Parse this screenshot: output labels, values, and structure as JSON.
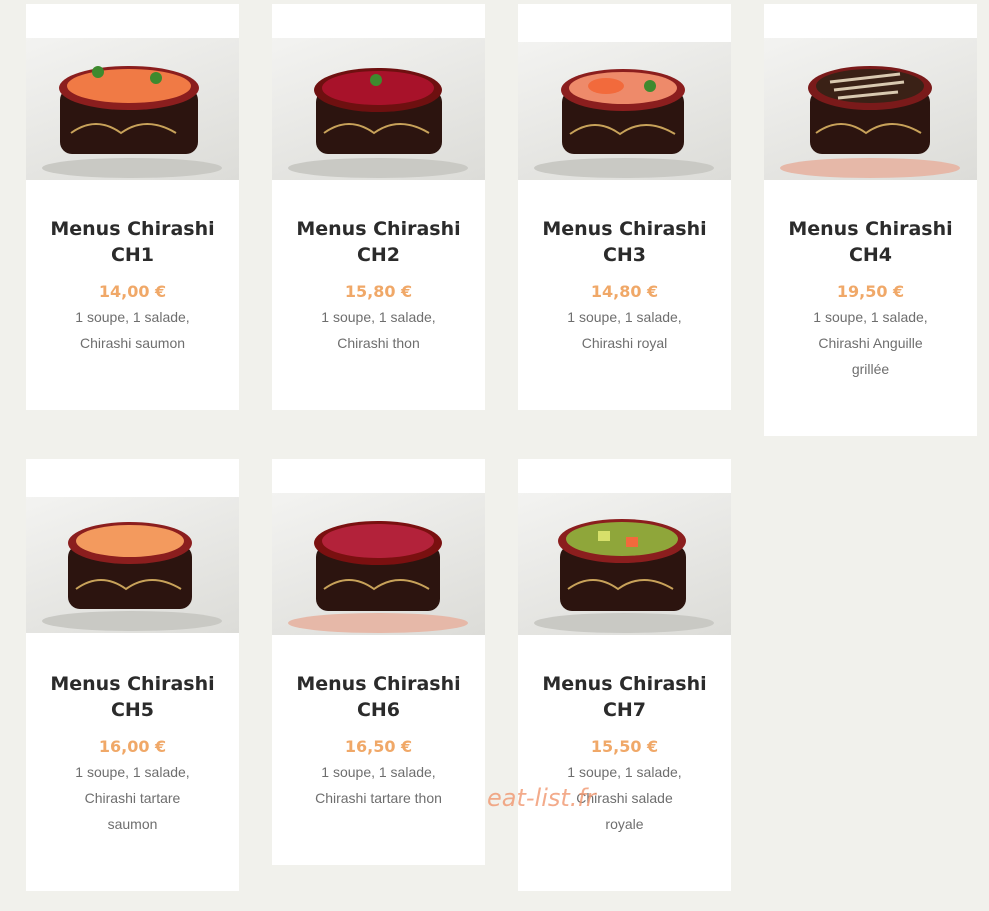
{
  "menu": {
    "items": [
      {
        "title": "Menus Chirashi\nCH1",
        "price": "14,00 €",
        "desc_line1": "1 soupe, 1 salade,",
        "desc_line2": "Chirashi saumon",
        "desc_line3": "",
        "food": "salmon"
      },
      {
        "title": "Menus Chirashi\nCH2",
        "price": "15,80 €",
        "desc_line1": "1 soupe, 1 salade,",
        "desc_line2": "Chirashi thon",
        "desc_line3": "",
        "food": "tuna"
      },
      {
        "title": "Menus Chirashi\nCH3",
        "price": "14,80 €",
        "desc_line1": "1 soupe, 1 salade,",
        "desc_line2": "Chirashi royal",
        "desc_line3": "",
        "food": "royal"
      },
      {
        "title": "Menus Chirashi\nCH4",
        "price": "19,50 €",
        "desc_line1": "1 soupe, 1 salade,",
        "desc_line2": "Chirashi Anguille",
        "desc_line3": "grillée",
        "food": "eel"
      },
      {
        "title": "Menus Chirashi\nCH5",
        "price": "16,00 €",
        "desc_line1": "1 soupe, 1 salade,",
        "desc_line2": "Chirashi tartare",
        "desc_line3": "saumon",
        "food": "salmon-tartare"
      },
      {
        "title": "Menus Chirashi\nCH6",
        "price": "16,50 €",
        "desc_line1": "1 soupe, 1 salade,",
        "desc_line2": "Chirashi tartare thon",
        "desc_line3": "",
        "food": "tuna-tartare"
      },
      {
        "title": "Menus Chirashi\nCH7",
        "price": "15,50 €",
        "desc_line1": "1 soupe, 1 salade,",
        "desc_line2": "Chirashi salade",
        "desc_line3": "royale",
        "food": "avocado"
      }
    ]
  },
  "watermark": "eat-list.fr",
  "colors": {
    "background": "#f1f1ec",
    "card": "#ffffff",
    "price": "#f0a868",
    "title": "#2b2b2b",
    "description": "#6e6e6e",
    "bowl": "#3a1a14",
    "bowl_rim": "#8b1e1e"
  }
}
